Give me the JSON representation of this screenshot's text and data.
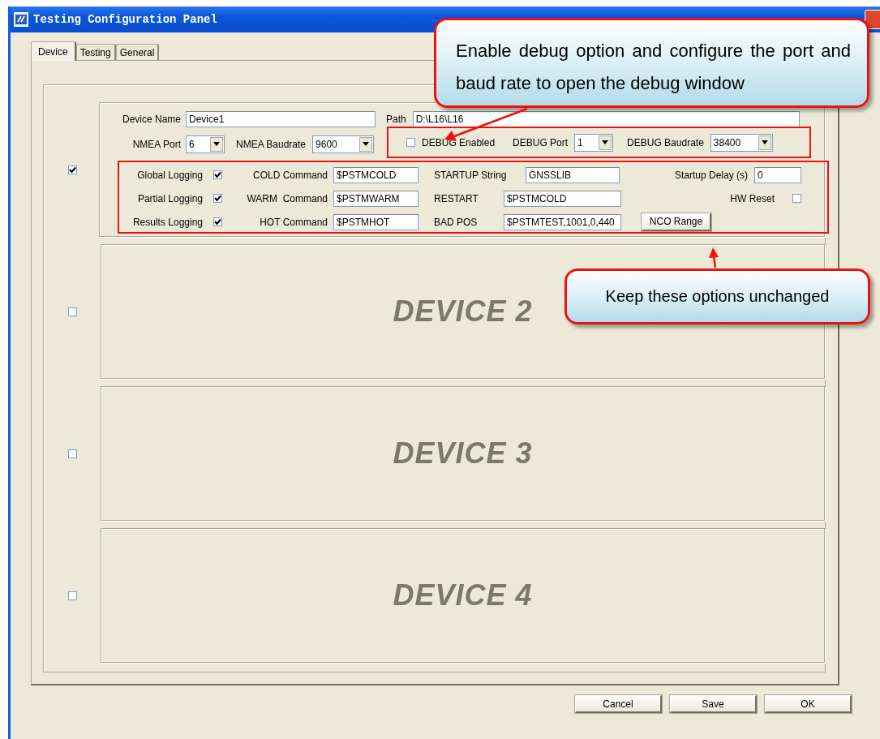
{
  "window": {
    "title": "Testing Configuration Panel"
  },
  "tabs": [
    {
      "label": "Device",
      "selected": true
    },
    {
      "label": "Testing",
      "selected": false
    },
    {
      "label": "General",
      "selected": false
    }
  ],
  "device1": {
    "enabled": true,
    "device_name": {
      "label": "Device Name",
      "value": "Device1"
    },
    "path": {
      "label": "Path",
      "value": "D:\\L16\\L16"
    },
    "nmea_port": {
      "label": "NMEA Port",
      "value": "6"
    },
    "nmea_baudrate": {
      "label": "NMEA Baudrate",
      "value": "9600"
    },
    "debug_enabled": {
      "label": "DEBUG Enabled",
      "checked": false
    },
    "debug_port": {
      "label": "DEBUG Port",
      "value": "1"
    },
    "debug_baudrate": {
      "label": "DEBUG Baudrate",
      "value": "38400"
    },
    "options": [
      {
        "logging": {
          "label": "Global Logging",
          "checked": true
        },
        "command": {
          "label": "COLD Command",
          "value": "$PSTMCOLD"
        },
        "second": {
          "label": "STARTUP String",
          "value": "GNSSLIB"
        },
        "extra": {
          "kind": "field",
          "label": "Startup Delay (s)",
          "value": "0"
        }
      },
      {
        "logging": {
          "label": "Partial Logging",
          "checked": true
        },
        "command": {
          "label": "WARM  Command",
          "value": "$PSTMWARM"
        },
        "second": {
          "label": "RESTART",
          "value": "$PSTMCOLD"
        },
        "extra": {
          "kind": "checkbox",
          "label": "HW Reset",
          "checked": false
        }
      },
      {
        "logging": {
          "label": "Results Logging",
          "checked": true
        },
        "command": {
          "label": "HOT Command",
          "value": "$PSTMHOT"
        },
        "second": {
          "label": "BAD POS",
          "value": "$PSTMTEST,1001,0,440"
        },
        "extra": {
          "kind": "button",
          "label": "NCO Range"
        }
      }
    ]
  },
  "other_devices": [
    {
      "enabled": false,
      "label": "DEVICE 2"
    },
    {
      "enabled": false,
      "label": "DEVICE 3"
    },
    {
      "enabled": false,
      "label": "DEVICE 4"
    }
  ],
  "buttons": [
    "Cancel",
    "Save",
    "OK"
  ],
  "callouts": [
    {
      "text": "Enable debug option and configure the port and baud rate to open the debug window"
    },
    {
      "text": "Keep these options unchanged"
    }
  ]
}
